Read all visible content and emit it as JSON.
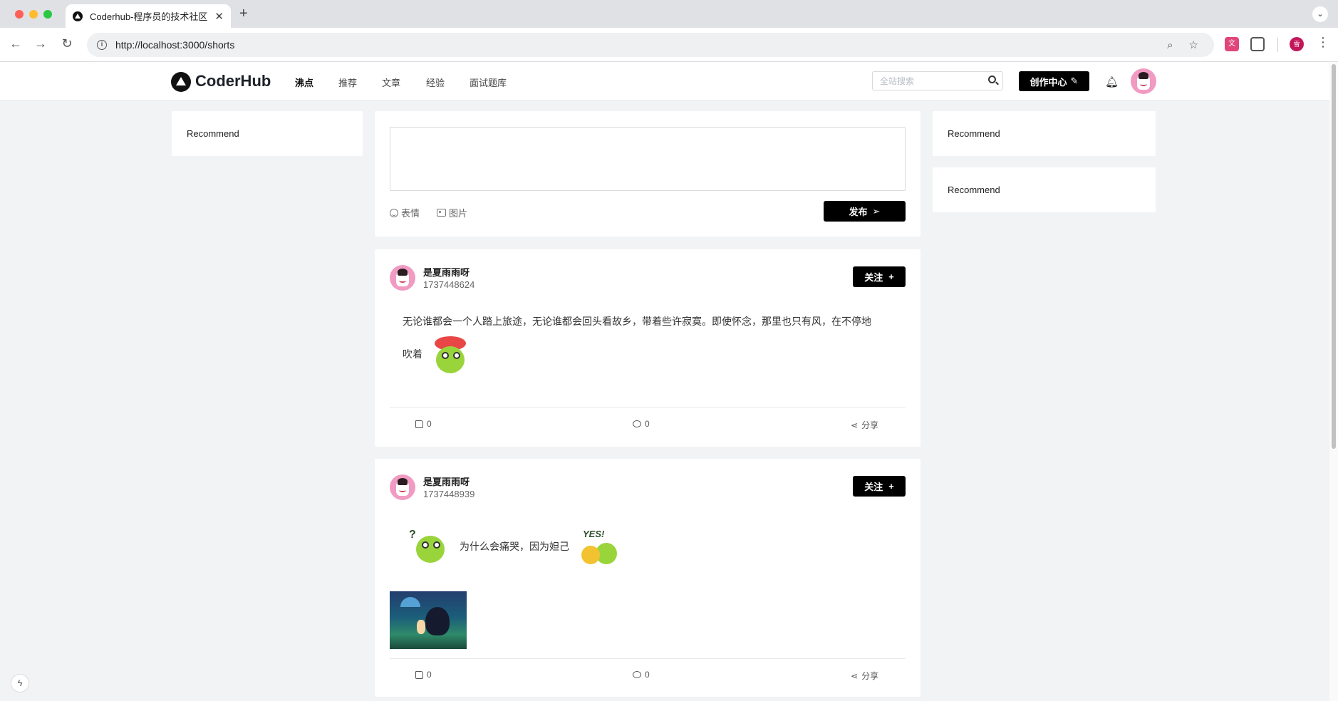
{
  "browser": {
    "tab_title": "Coderhub-程序员的技术社区",
    "tab_close": "✕",
    "new_tab": "+",
    "url": "http://localhost:3000/shorts",
    "profile_initial": "雪"
  },
  "site": {
    "logo_text": "CoderHub",
    "nav": [
      "沸点",
      "推荐",
      "文章",
      "经验",
      "面试题库"
    ],
    "active_nav": "沸点",
    "search_placeholder": "全站搜索",
    "create_label": "创作中心"
  },
  "sidebar_left": {
    "recommend": "Recommend"
  },
  "sidebar_right": {
    "recommend_1": "Recommend",
    "recommend_2": "Recommend"
  },
  "editor": {
    "emoji_label": "表情",
    "image_label": "图片",
    "publish_label": "发布"
  },
  "posts": [
    {
      "author": "是夏雨雨呀",
      "timestamp": "1737448624",
      "follow_label": "关注",
      "text_line1": "无论谁都会一个人踏上旅途，无论谁都会回头看故乡，带着些许寂寞。即使怀念，那里也只有风，在不停地",
      "text_line2": "吹着",
      "likes": "0",
      "comments": "0",
      "share_label": "分享"
    },
    {
      "author": "是夏雨雨呀",
      "timestamp": "1737448939",
      "follow_label": "关注",
      "text": "为什么会痛哭，因为妲己",
      "sticker_text": "YES!",
      "likes": "0",
      "comments": "0",
      "share_label": "分享"
    }
  ]
}
